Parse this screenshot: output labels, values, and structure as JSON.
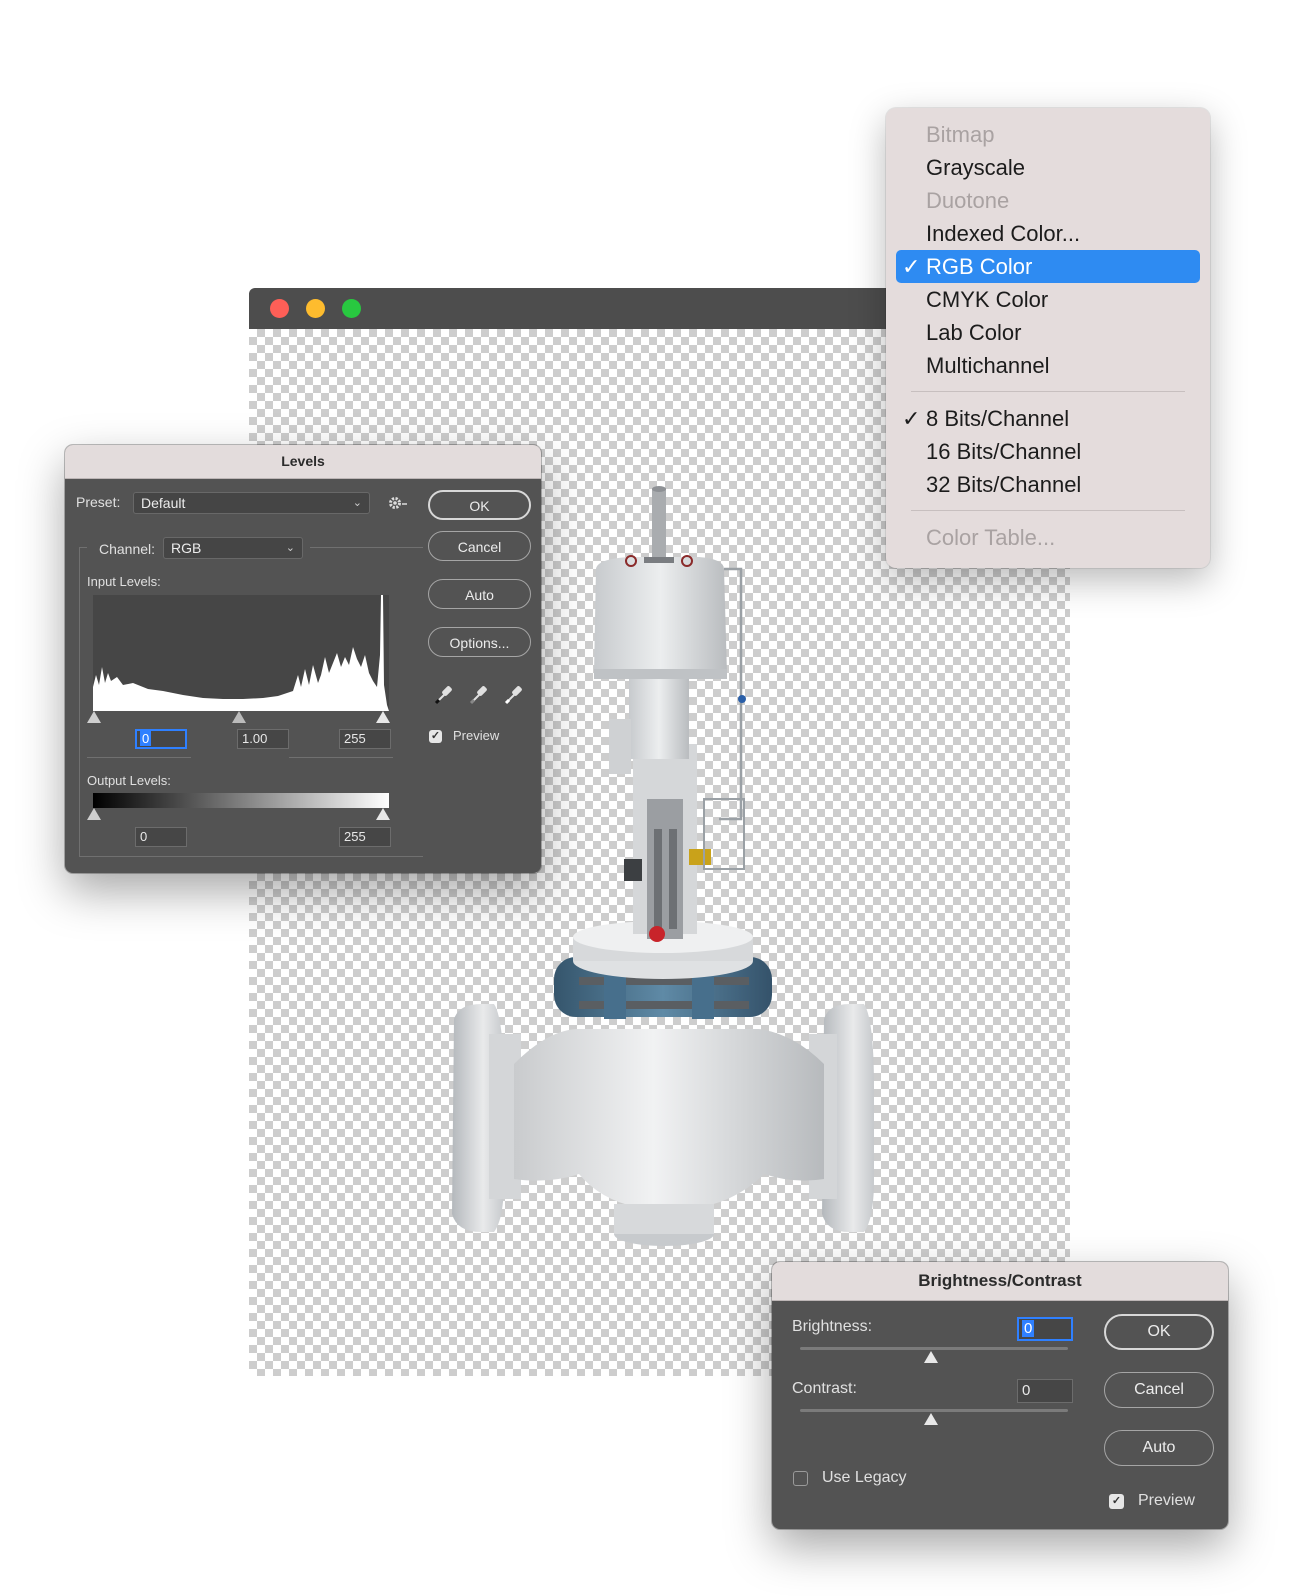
{
  "levels": {
    "title": "Levels",
    "preset_label": "Preset:",
    "preset_value": "Default",
    "channel_label": "Channel:",
    "channel_value": "RGB",
    "input_levels_label": "Input Levels:",
    "input_black": "0",
    "input_gamma": "1.00",
    "input_white": "255",
    "output_levels_label": "Output Levels:",
    "output_black": "0",
    "output_white": "255",
    "buttons": {
      "ok": "OK",
      "cancel": "Cancel",
      "auto": "Auto",
      "options": "Options..."
    },
    "preview_label": "Preview",
    "preview_checked": true
  },
  "brightness_contrast": {
    "title": "Brightness/Contrast",
    "brightness_label": "Brightness:",
    "brightness_value": "0",
    "contrast_label": "Contrast:",
    "contrast_value": "0",
    "use_legacy_label": "Use Legacy",
    "use_legacy_checked": false,
    "preview_label": "Preview",
    "preview_checked": true,
    "buttons": {
      "ok": "OK",
      "cancel": "Cancel",
      "auto": "Auto"
    }
  },
  "mode_menu": {
    "items": [
      {
        "label": "Bitmap",
        "enabled": false,
        "checked": false,
        "selected": false
      },
      {
        "label": "Grayscale",
        "enabled": true,
        "checked": false,
        "selected": false
      },
      {
        "label": "Duotone",
        "enabled": false,
        "checked": false,
        "selected": false
      },
      {
        "label": "Indexed Color...",
        "enabled": true,
        "checked": false,
        "selected": false
      },
      {
        "label": "RGB Color",
        "enabled": true,
        "checked": true,
        "selected": true
      },
      {
        "label": "CMYK Color",
        "enabled": true,
        "checked": false,
        "selected": false
      },
      {
        "label": "Lab Color",
        "enabled": true,
        "checked": false,
        "selected": false
      },
      {
        "label": "Multichannel",
        "enabled": true,
        "checked": false,
        "selected": false
      },
      {
        "label": "8 Bits/Channel",
        "enabled": true,
        "checked": true,
        "selected": false
      },
      {
        "label": "16 Bits/Channel",
        "enabled": true,
        "checked": false,
        "selected": false
      },
      {
        "label": "32 Bits/Channel",
        "enabled": true,
        "checked": false,
        "selected": false
      },
      {
        "label": "Color Table...",
        "enabled": false,
        "checked": false,
        "selected": false
      }
    ]
  },
  "colors": {
    "accent": "#2e8bf2",
    "dialog_bg": "#535353",
    "menu_bg": "#e4dcdc",
    "titlebar": "#4d4d4d"
  },
  "icons": [
    "close-icon",
    "minimize-icon",
    "zoom-icon",
    "gear-icon",
    "black-eyedropper-icon",
    "gray-eyedropper-icon",
    "white-eyedropper-icon",
    "checkmark-icon"
  ]
}
